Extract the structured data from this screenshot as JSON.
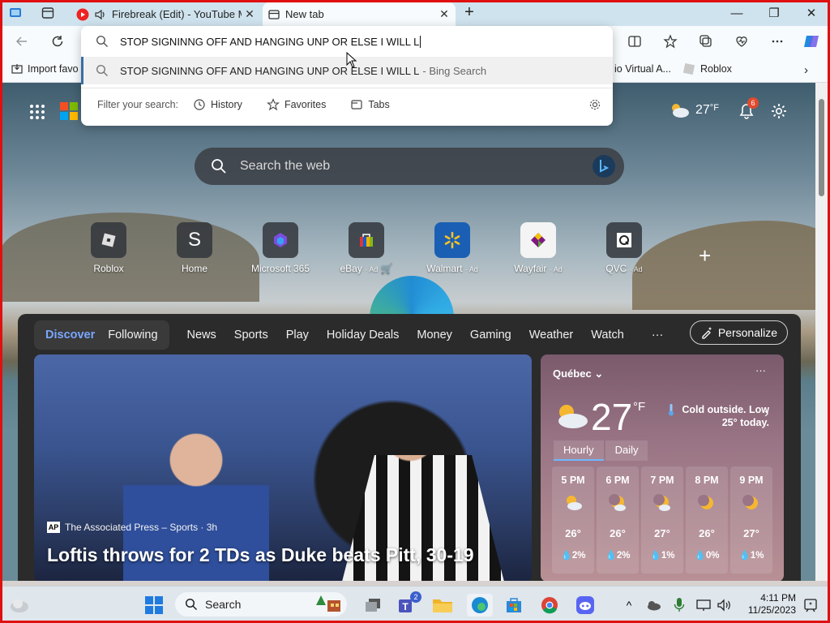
{
  "tabs": [
    {
      "title": "Firebreak (Edit) - YouTube M",
      "close": "✕"
    },
    {
      "title": "New tab",
      "close": "✕"
    }
  ],
  "new_tab_label": "+",
  "window_controls": {
    "minimize": "—",
    "maximize": "❐",
    "close": "✕"
  },
  "omnibox": {
    "value": "STOP SIGNINNG OFF  AND HANGING UNP OR ELSE I WILL L",
    "suggestion": "STOP SIGNINNG OFF AND HANGING UNP OR ELSE I WILL L",
    "suggestion_suffix": "- Bing Search",
    "filter_label": "Filter your search:",
    "filters": [
      "History",
      "Favorites",
      "Tabs"
    ]
  },
  "favorites": {
    "import": "Import favo",
    "virtual": "io Virtual A...",
    "roblox": "Roblox"
  },
  "newtab": {
    "weather_temp": "27",
    "weather_unit": "°F",
    "notifications": "6",
    "search_placeholder": "Search the web",
    "tiles": [
      {
        "label": "Roblox",
        "ad": ""
      },
      {
        "label": "Home",
        "ad": ""
      },
      {
        "label": "Microsoft 365",
        "ad": ""
      },
      {
        "label": "eBay",
        "ad": "· Ad"
      },
      {
        "label": "Walmart",
        "ad": "· Ad"
      },
      {
        "label": "Wayfair",
        "ad": "· Ad"
      },
      {
        "label": "QVC",
        "ad": "· Ad"
      }
    ],
    "home_letter": "S",
    "add_label": "+"
  },
  "feed": {
    "segments": [
      "Discover",
      "Following"
    ],
    "nav": [
      "News",
      "Sports",
      "Play",
      "Holiday Deals",
      "Money",
      "Gaming",
      "Weather",
      "Watch",
      "···"
    ],
    "personalize": "Personalize",
    "hero": {
      "source_logo": "AP",
      "source": "The Associated Press – Sports · 3h",
      "title": "Loftis throws for 2 TDs as Duke beats Pitt, 30-19"
    },
    "weather": {
      "location": "Québec",
      "more": "···",
      "temp": "27",
      "unit": "°F",
      "alert": "Cold outside. Low 25° today.",
      "tabs": [
        "Hourly",
        "Daily"
      ],
      "hours": [
        {
          "time": "5 PM",
          "temp": "26°",
          "precip": "💧2%"
        },
        {
          "time": "6 PM",
          "temp": "26°",
          "precip": "💧2%"
        },
        {
          "time": "7 PM",
          "temp": "27°",
          "precip": "💧1%"
        },
        {
          "time": "8 PM",
          "temp": "26°",
          "precip": "💧0%"
        },
        {
          "time": "9 PM",
          "temp": "27°",
          "precip": "💧1%"
        }
      ]
    }
  },
  "taskbar": {
    "search_label": "Search",
    "teams_badge": "2",
    "time": "4:11 PM",
    "date": "11/25/2023"
  },
  "colors": {
    "accent": "#0078d4",
    "frame": "#e01010"
  }
}
